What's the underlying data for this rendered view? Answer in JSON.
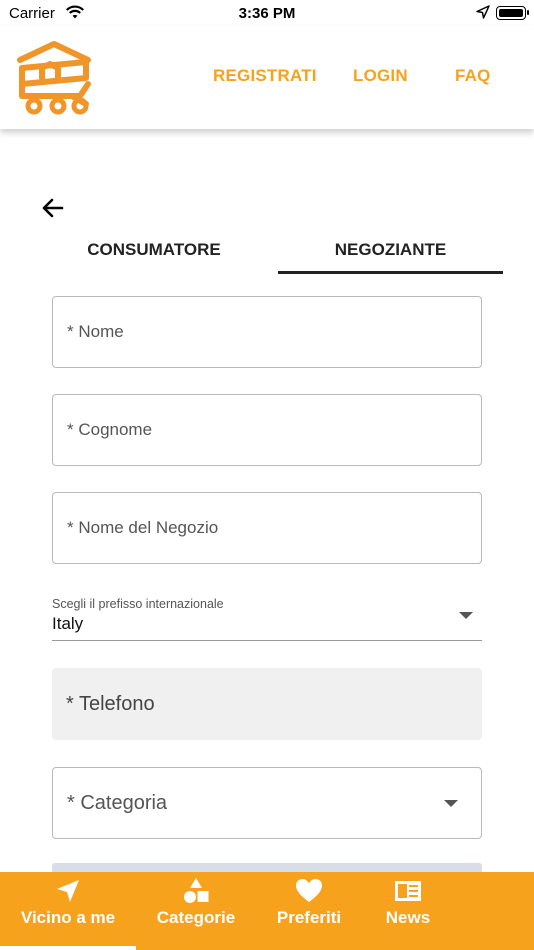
{
  "status_bar": {
    "carrier": "Carrier",
    "time": "3:36 PM"
  },
  "header": {
    "nav": {
      "register": "REGISTRATI",
      "login": "LOGIN",
      "faq": "FAQ"
    },
    "accent_color": "#f7a21d"
  },
  "tabs": {
    "consumer": "CONSUMATORE",
    "merchant": "NEGOZIANTE",
    "active": "merchant"
  },
  "form": {
    "first_name": {
      "placeholder": "* Nome",
      "value": ""
    },
    "last_name": {
      "placeholder": "* Cognome",
      "value": ""
    },
    "shop_name": {
      "placeholder": "* Nome del Negozio",
      "value": ""
    },
    "prefix": {
      "label": "Scegli il prefisso internazionale",
      "value": "Italy"
    },
    "phone": {
      "placeholder": "* Telefono",
      "value": ""
    },
    "category": {
      "placeholder": "* Categoria",
      "value": ""
    }
  },
  "bottom_nav": {
    "items": [
      {
        "label": "Vicino a me",
        "icon": "navigation-arrow-icon",
        "active": true
      },
      {
        "label": "Categorie",
        "icon": "shapes-icon"
      },
      {
        "label": "Preferiti",
        "icon": "heart-icon"
      },
      {
        "label": "News",
        "icon": "newspaper-icon"
      }
    ]
  }
}
